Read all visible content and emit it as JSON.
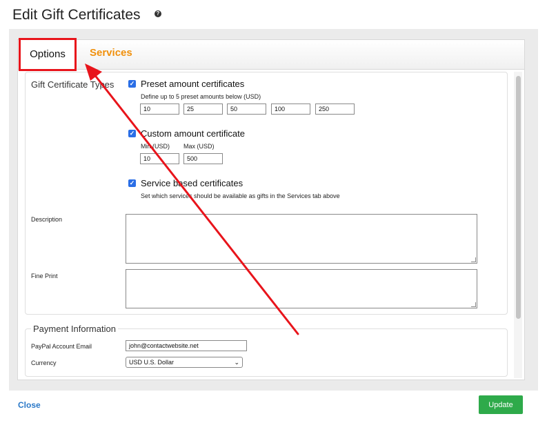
{
  "page": {
    "title": "Edit Gift Certificates",
    "help_icon": "question-circle-icon"
  },
  "tabs": {
    "options": "Options",
    "services": "Services"
  },
  "types": {
    "label": "Gift Certificate Types",
    "preset": {
      "label": "Preset amount certificates",
      "hint": "Define up to 5 preset amounts below (USD)",
      "amounts": [
        "10",
        "25",
        "50",
        "100",
        "250"
      ]
    },
    "custom": {
      "label": "Custom amount certificate",
      "min_label": "Min (USD)",
      "max_label": "Max (USD)",
      "min": "10",
      "max": "500"
    },
    "service": {
      "label": "Service based certificates",
      "hint": "Set which services should be available as gifts in the Services tab above"
    }
  },
  "description": {
    "label": "Description",
    "value": ""
  },
  "fine_print": {
    "label": "Fine Print",
    "value": ""
  },
  "payment": {
    "title": "Payment Information",
    "email_label": "PayPal Account Email",
    "email": "john@contactwebsite.net",
    "currency_label": "Currency",
    "currency": "USD U.S. Dollar"
  },
  "footer": {
    "close": "Close",
    "update": "Update"
  },
  "colors": {
    "accent_orange": "#f0900c",
    "highlight_red": "#e8141b",
    "update_green": "#2eaa4a",
    "link_blue": "#2a78c8"
  }
}
